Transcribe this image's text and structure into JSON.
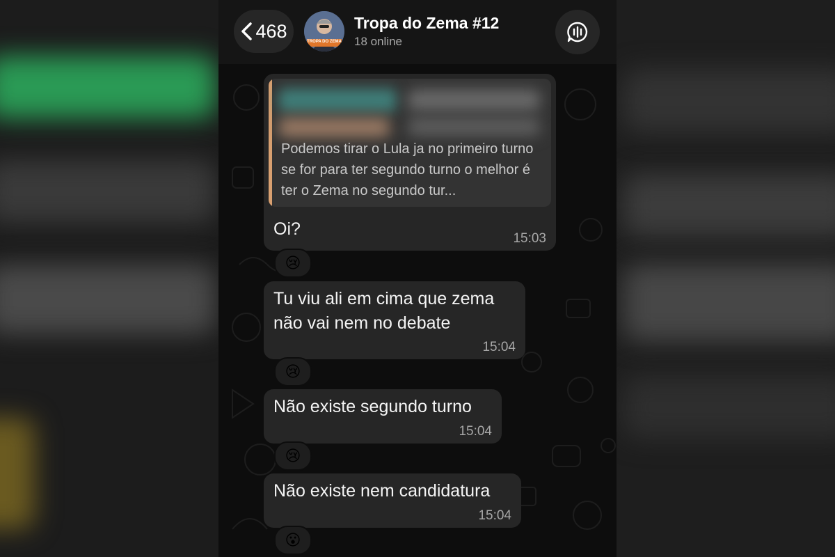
{
  "header": {
    "back_count": "468",
    "title": "Tropa do Zema #12",
    "subtitle": "18 online",
    "avatar_caption": "TROPA DO ZEMA"
  },
  "icons": {
    "back": "chevron-left-icon",
    "call": "voice-chat-icon",
    "reaction": "crying-face-emoji"
  },
  "messages": [
    {
      "quote": "Podemos tirar o Lula ja no primeiro turno se for para ter segundo turno o melhor é ter o Zema no segundo tur...",
      "text": "Oi?",
      "time": "15:03",
      "reaction": "😢"
    },
    {
      "text_line1": "Tu viu ali em cima que zema",
      "text_line2": "não vai nem no debate",
      "time": "15:04",
      "reaction": "😢"
    },
    {
      "text": "Não existe segundo turno",
      "time": "15:04",
      "reaction": "😢"
    },
    {
      "text": "Não existe nem candidatura",
      "time": "15:04",
      "reaction": "😮"
    }
  ],
  "colors": {
    "bubble": "#262626",
    "quote_accent": "#d9a070",
    "background": "#0d0d0d"
  }
}
